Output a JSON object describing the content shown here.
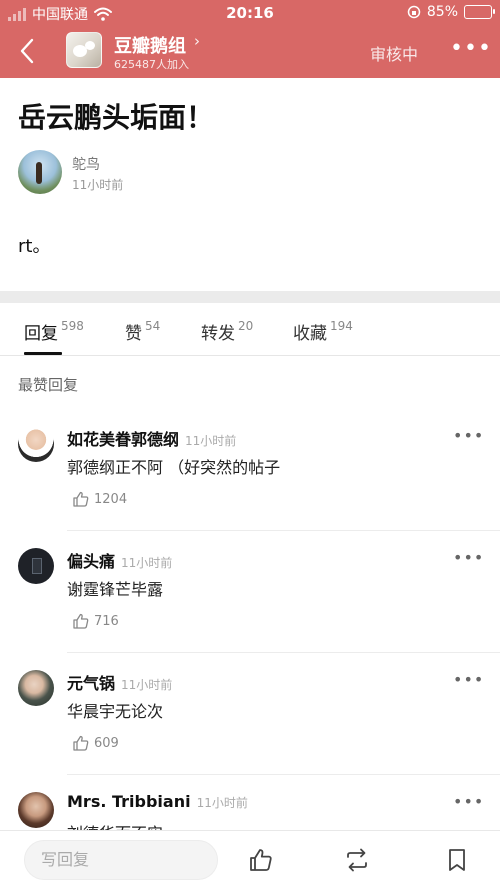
{
  "status_bar": {
    "carrier": "中国联通",
    "time": "20:16",
    "battery_percent": "85%",
    "battery_level": 0.85
  },
  "header": {
    "group_name": "豆瓣鹅组",
    "group_members": "625487人加入",
    "review_label": "审核中",
    "more_label": "•••"
  },
  "post": {
    "title": "岳云鹏头垢面！",
    "author": "鸵鸟",
    "time": "11小时前",
    "body": "rt。"
  },
  "tabs": [
    {
      "label": "回复",
      "count": "598"
    },
    {
      "label": "赞",
      "count": "54"
    },
    {
      "label": "转发",
      "count": "20"
    },
    {
      "label": "收藏",
      "count": "194"
    }
  ],
  "section_label": "最赞回复",
  "comments": [
    {
      "name": "如花美眷郭德纲",
      "time": "11小时前",
      "text": "郭德纲正不阿 （好突然的帖子",
      "likes": "1204",
      "more": "•••"
    },
    {
      "name": "偏头痛",
      "time": "11小时前",
      "text": "谢霆锋芒毕露",
      "likes": "716",
      "more": "•••"
    },
    {
      "name": "元气锅",
      "time": "11小时前",
      "text": "华晨宇无论次",
      "likes": "609",
      "more": "•••"
    },
    {
      "name": "Mrs. Tribbiani",
      "time": "11小时前",
      "text": "刘德华而不实",
      "likes": "",
      "more": "•••"
    }
  ],
  "bottom_bar": {
    "reply_placeholder": "写回复"
  },
  "colors": {
    "header_bg": "#d86866",
    "accent_text": "#111111"
  }
}
